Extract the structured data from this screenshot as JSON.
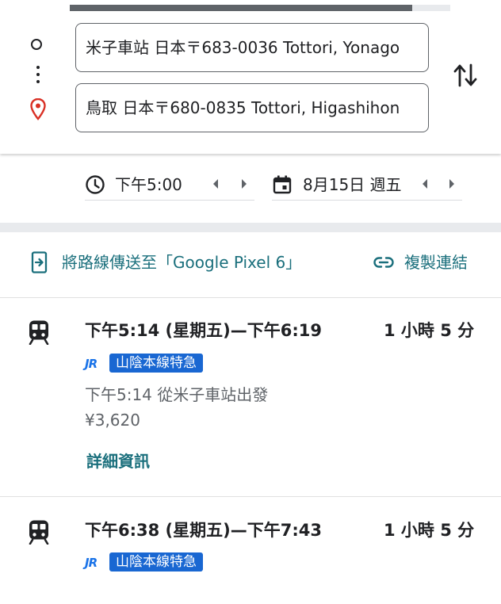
{
  "directions": {
    "origin": "米子車站 日本〒683-0036 Tottori, Yonago",
    "destination": "鳥取 日本〒680-0835 Tottori, Higashihon"
  },
  "time_picker": {
    "time": "下午5:00",
    "date": "8月15日 週五"
  },
  "actions": {
    "send_label": "將路線傳送至「Google Pixel 6」",
    "copy_link_label": "複製連結"
  },
  "routes": [
    {
      "times": "下午5:14 (星期五)—下午6:19",
      "duration": "1 小時 5 分",
      "operator_logo": "JR",
      "line": "山陰本線特急",
      "departure": "下午5:14 從米子車站出發",
      "fare": "¥3,620",
      "details_label": "詳細資訊"
    },
    {
      "times": "下午6:38 (星期五)—下午7:43",
      "duration": "1 小時 5 分",
      "operator_logo": "JR",
      "line": "山陰本線特急"
    }
  ],
  "colors": {
    "accent": "#1a6f7c",
    "line_badge": "#1967d2",
    "pin": "#d93025"
  }
}
